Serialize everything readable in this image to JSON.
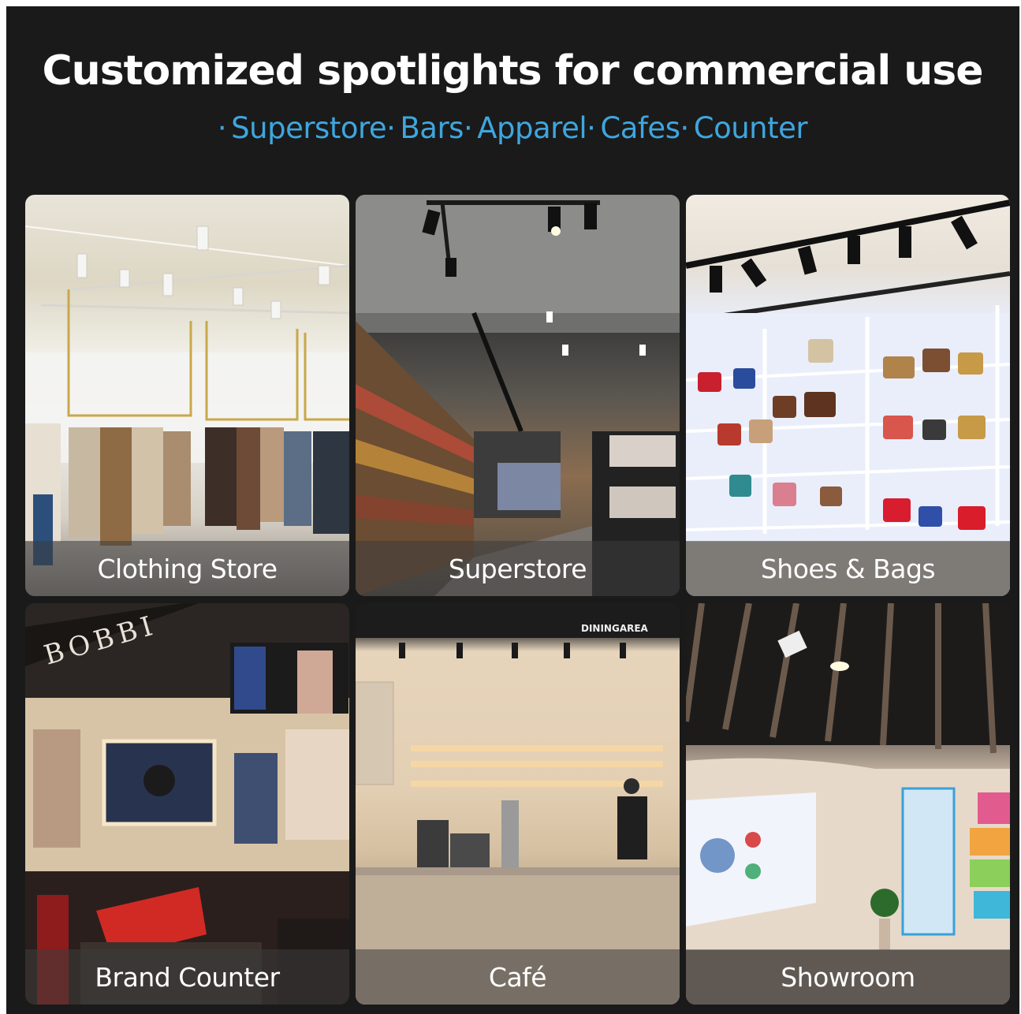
{
  "header": {
    "title": "Customized spotlights for commercial use",
    "subtitle_items": [
      "Superstore",
      "Bars",
      "Apparel",
      "Cafes",
      "Counter"
    ],
    "subtitle_separator": "·"
  },
  "tiles": [
    {
      "caption": "Clothing Store"
    },
    {
      "caption": "Superstore"
    },
    {
      "caption": "Shoes & Bags"
    },
    {
      "caption": "Brand Counter",
      "sign_text": "BOBBI"
    },
    {
      "caption": "Café",
      "sign_text": "DININGAREA"
    },
    {
      "caption": "Showroom"
    }
  ],
  "colors": {
    "background": "#1a1a1a",
    "title": "#ffffff",
    "subtitle": "#3ea6df"
  }
}
